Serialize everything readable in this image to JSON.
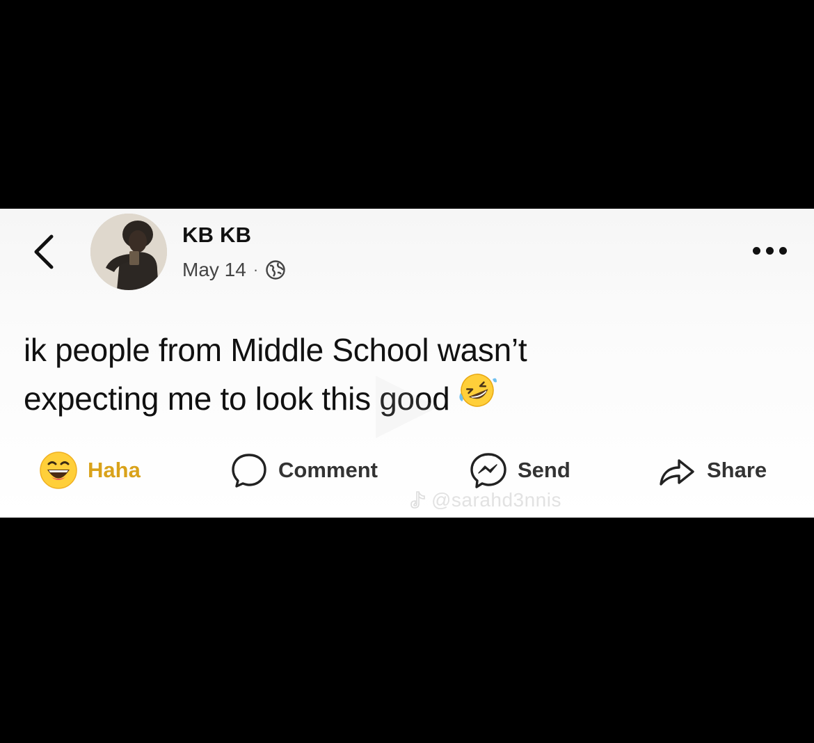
{
  "post": {
    "author_name": "KB KB",
    "date": "May 14",
    "meta_separator": "·",
    "text_line_1": "ik people from Middle School wasn’t",
    "text_line_2": "expecting me to look this good"
  },
  "icons": {
    "back": "chevron-left-icon",
    "privacy": "globe-icon",
    "more": "more-horizontal-icon",
    "inline_emoji": "rolling-on-floor-laughing-emoji",
    "haha": "haha-reaction-icon",
    "comment": "comment-bubble-icon",
    "send": "messenger-icon",
    "share": "share-arrow-icon"
  },
  "actions": {
    "haha_label": "Haha",
    "comment_label": "Comment",
    "send_label": "Send",
    "share_label": "Share"
  },
  "watermark": {
    "handle": "@sarahd3nnis"
  },
  "colors": {
    "haha_accent": "#d9a21a",
    "emoji_yellow": "#ffcf3a",
    "letterbox": "#000000"
  }
}
